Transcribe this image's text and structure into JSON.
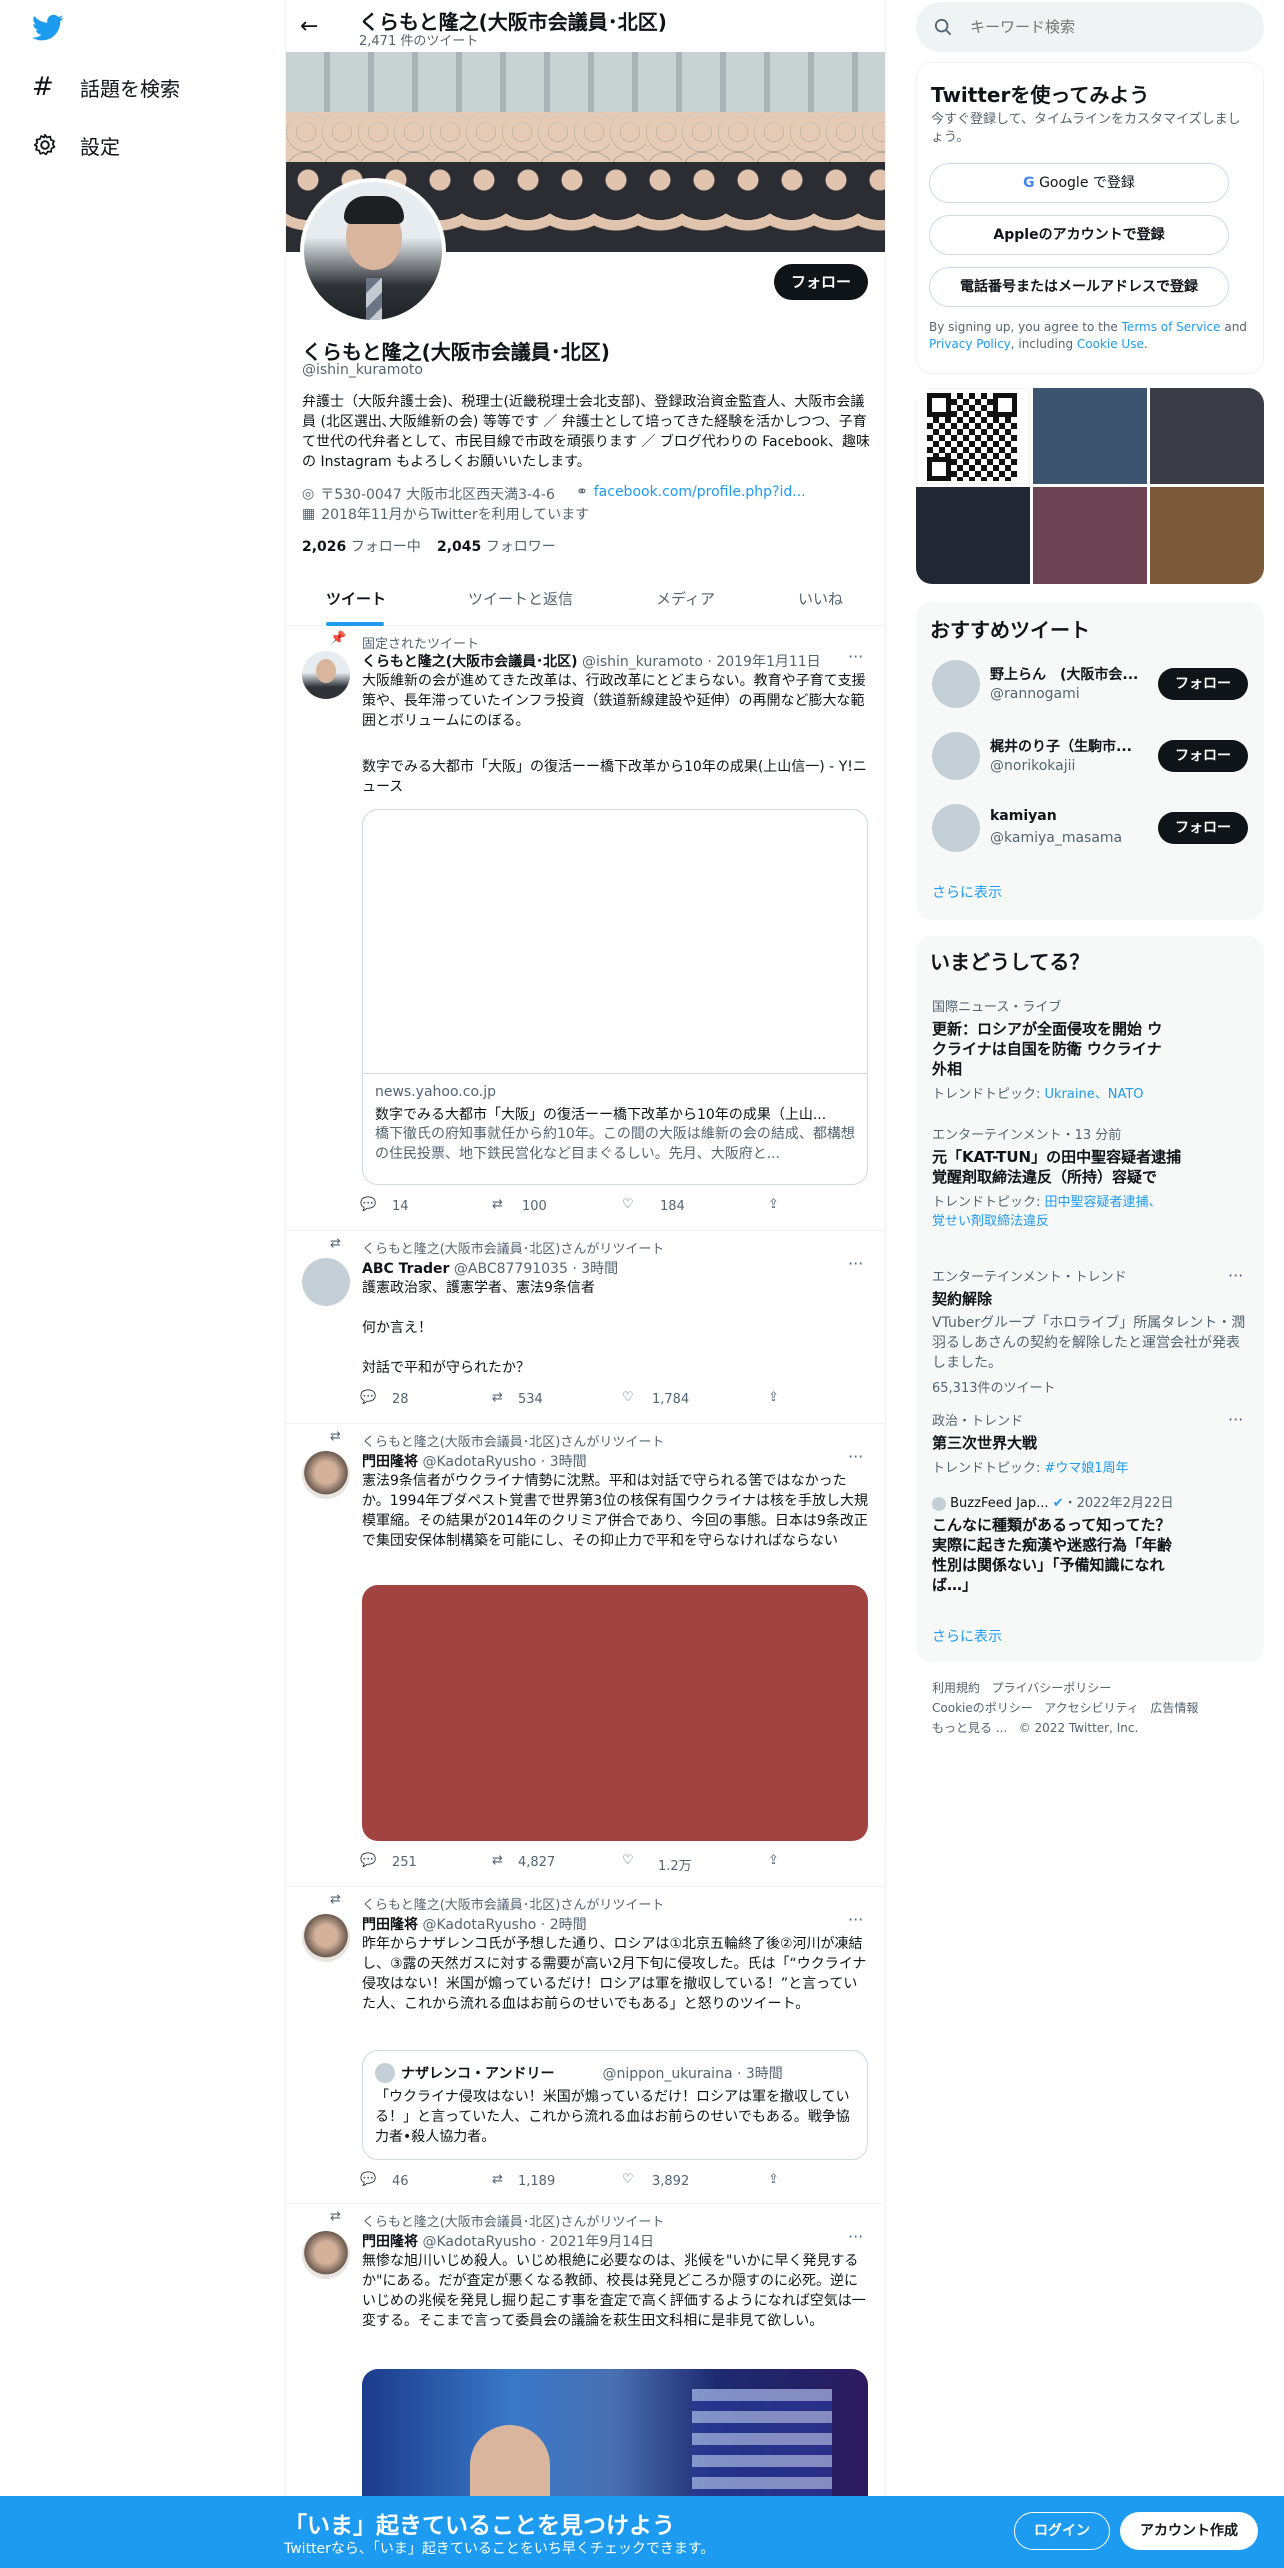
{
  "nav": {
    "explore": "話題を検索",
    "settings": "設定"
  },
  "header": {
    "name": "くらもと隆之(大阪市会議員･北区)",
    "tweet_count": "2,471 件のツイート"
  },
  "profile": {
    "name": "くらもと隆之(大阪市会議員･北区)",
    "handle": "@ishin_kuramoto",
    "follow": "フォロー",
    "bio": "弁護士（大阪弁護士会)、税理士(近畿税理士会北支部)、登録政治資金監査人、大阪市会議員 (北区選出､大阪維新の会) 等等です ／ 弁護士として培ってきた経験を活かしつつ、子育て世代の代弁者として、市民目線で市政を頑張ります ／ ブログ代わりの Facebook、趣味の Instagram もよろしくお願いいたします。",
    "location": "〒530-0047 大阪市北区西天満3-4-6",
    "link": "facebook.com/profile.php?id...",
    "joined": "2018年11月からTwitterを利用しています",
    "following_count": "2,026",
    "following_label": "フォロー中",
    "followers_count": "2,045",
    "followers_label": "フォロワー"
  },
  "tabs": [
    "ツイート",
    "ツイートと返信",
    "メディア",
    "いいね"
  ],
  "tweets": [
    {
      "pinned": "固定されたツイート",
      "name": "くらもと隆之(大阪市会議員･北区)",
      "handle": "@ishin_kuramoto",
      "time": "2019年1月11日",
      "text1": "大阪維新の会が進めてきた改革は、行政改革にとどまらない。教育や子育て支援策や、長年滞っていたインフラ投資（鉄道新線建設や延伸）の再開など膨大な範囲とボリュームにのぼる。",
      "text2": "数字でみる大都市「大阪」の復活ーー橋下改革から10年の成果(上山信一) - Y!ニュース",
      "card_domain": "news.yahoo.co.jp",
      "card_title": "数字でみる大都市「大阪」の復活ーー橋下改革から10年の成果（上山...",
      "card_desc": "橋下徹氏の府知事就任から約10年。この間の大阪は維新の会の結成、都構想の住民投票、地下鉄民営化など目まぐるしい。先月、大阪府と...",
      "replies": "14",
      "retweets": "100",
      "likes": "184"
    },
    {
      "rt": "くらもと隆之(大阪市会議員･北区)さんがリツイート",
      "name": "ABC Trader",
      "handle": "@ABC87791035",
      "time": "3時間",
      "text1": "護憲政治家、護憲学者、憲法9条信者",
      "text2": "何か言え！",
      "text3": "対話で平和が守られたか？",
      "replies": "28",
      "retweets": "534",
      "likes": "1,784"
    },
    {
      "rt": "くらもと隆之(大阪市会議員･北区)さんがリツイート",
      "name": "門田隆将",
      "handle": "@KadotaRyusho",
      "time": "3時間",
      "text1": "憲法9条信者がウクライナ情勢に沈黙。平和は対話で守られる筈ではなかったか。1994年ブダペスト覚書で世界第3位の核保有国ウクライナは核を手放し大規模軍縮。その結果が2014年のクリミア併合であり、今回の事態。日本は9条改正で集団安保体制構築を可能にし、その抑止力で平和を守らなければならない",
      "replies": "251",
      "retweets": "4,827",
      "likes": "1.2万"
    },
    {
      "rt": "くらもと隆之(大阪市会議員･北区)さんがリツイート",
      "name": "門田隆将",
      "handle": "@KadotaRyusho",
      "time": "2時間",
      "text1": "昨年からナザレンコ氏が予想した通り、ロシアは①北京五輪終了後②河川が凍結し、③露の天然ガスに対する需要が高い2月下旬に侵攻した。氏は「“ウクライナ侵攻はない！米国が煽っているだけ！ロシアは軍を撤収している！”と言っていた人、これから流れる血はお前らのせいでもある」と怒りのツイート。",
      "q_name": "ナザレンコ・アンドリー",
      "q_handle": "@nippon_ukuraina",
      "q_time": "3時間",
      "q_text": "「ウクライナ侵攻はない！米国が煽っているだけ！ロシアは軍を撤収している！」と言っていた人、これから流れる血はお前らのせいでもある。戦争協力者•殺人協力者。",
      "replies": "46",
      "retweets": "1,189",
      "likes": "3,892"
    },
    {
      "rt": "くらもと隆之(大阪市会議員･北区)さんがリツイート",
      "name": "門田隆将",
      "handle": "@KadotaRyusho",
      "time": "2021年9月14日",
      "text1": "無惨な旭川いじめ殺人。いじめ根絶に必要なのは、兆候を\"いかに早く発見するか\"にある。だが査定が悪くなる教師、校長は発見どころか隠すのに必死。逆にいじめの兆候を発見し掘り起こす事を査定で高く評価するようになれば空気は一変する。そこまで言って委員会の議論を萩生田文科相に是非見て欲しい。"
    }
  ],
  "search": {
    "placeholder": "キーワード検索"
  },
  "signup": {
    "title": "Twitterを使ってみよう",
    "sub": "今すぐ登録して、タイムラインをカスタマイズしましょう。",
    "google": "Google で登録",
    "apple": "Appleのアカウントで登録",
    "phone": "電話番号またはメールアドレスで登録",
    "terms1": "By signing up, you agree to the ",
    "terms_link": "Terms of Service",
    "terms2": " and ",
    "privacy": "Privacy Policy",
    "terms3": ", including ",
    "cookie": "Cookie Use",
    "terms4": "."
  },
  "who": {
    "title": "おすすめツイート",
    "users": [
      {
        "name": "野上らん　(大阪市会...",
        "handle": "@rannogami",
        "follow": "フォロー"
      },
      {
        "name": "梶井のり子（生駒市...",
        "handle": "@norikokajii",
        "follow": "フォロー"
      },
      {
        "name": "kamiyan",
        "handle": "@kamiya_masama",
        "follow": "フォロー"
      }
    ],
    "more": "さらに表示"
  },
  "trends": {
    "title": "いまどうしてる？",
    "items": [
      {
        "meta": "国際ニュース・ライブ",
        "title": "更新：ロシアが全面侵攻を開始 ウクライナは自国を防衛 ウクライナ外相",
        "sub_label": "トレンドトピック: ",
        "sub_links": "Ukraine、NATO"
      },
      {
        "meta": "エンターテインメント・13 分前",
        "title": "元「KAT-TUN」の田中聖容疑者逮捕 覚醒剤取締法違反（所持）容疑で",
        "sub_label": "トレンドトピック: ",
        "sub_links": "田中聖容疑者逮捕、覚せい剤取締法違反"
      },
      {
        "meta": "エンターテインメント・トレンド",
        "title": "契約解除",
        "desc": "VTuberグループ「ホロライブ」所属タレント・潤羽るしあさんの契約を解除したと運営会社が発表しました。",
        "count": "65,313件のツイート"
      },
      {
        "meta": "政治・トレンド",
        "title": "第三次世界大戦",
        "sub_label": "トレンドトピック: ",
        "sub_links": "#ウマ娘1周年"
      },
      {
        "meta_name": "BuzzFeed Jap...",
        "meta_date": "・2022年2月22日",
        "title": "こんなに種類があるって知ってた？ 実際に起きた痴漢や迷惑行為「年齢性別は関係ない」「予備知識になれば…」"
      }
    ],
    "more": "さらに表示"
  },
  "footer": {
    "l1": "利用規約",
    "l2": "プライバシーポリシー",
    "l3": "Cookieのポリシー",
    "l4": "アクセシビリティ",
    "l5": "広告情報",
    "l6": "もっと見る ...",
    "copy": "© 2022 Twitter, Inc."
  },
  "bottom": {
    "title": "「いま」起きていることを見つけよう",
    "sub": "Twitterなら、「いま」起きていることをいち早くチェックできます。",
    "login": "ログイン",
    "signup": "アカウント作成"
  },
  "colors": {
    "accent": "#1d9bf0",
    "dark": "#0f1419",
    "bottom_bar": "#1d9bf0"
  }
}
